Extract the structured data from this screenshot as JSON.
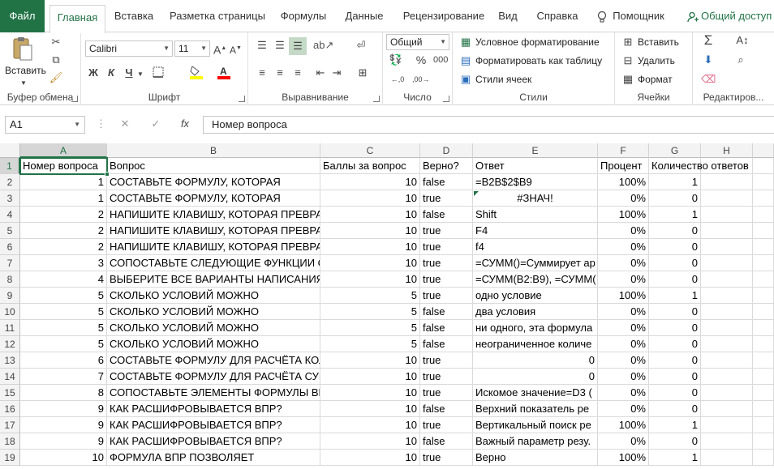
{
  "tabs": [
    {
      "label": "Файл"
    },
    {
      "label": "Главная"
    },
    {
      "label": "Вставка"
    },
    {
      "label": "Разметка страницы"
    },
    {
      "label": "Формулы"
    },
    {
      "label": "Данные"
    },
    {
      "label": "Рецензирование"
    },
    {
      "label": "Вид"
    },
    {
      "label": "Справка"
    }
  ],
  "tell_me": "Помощник",
  "share": "Общий доступ",
  "ribbon": {
    "clipboard": {
      "paste": "Вставить",
      "label": "Буфер обмена"
    },
    "font": {
      "name": "Calibri",
      "size": "11",
      "bold": "Ж",
      "italic": "К",
      "underline": "Ч",
      "label": "Шрифт"
    },
    "alignment": {
      "label": "Выравнивание"
    },
    "number": {
      "format": "Общий",
      "percent": "%",
      "label": "Число"
    },
    "styles": {
      "conditional": "Условное форматирование",
      "as_table": "Форматировать как таблицу",
      "cell_styles": "Стили ячеек",
      "label": "Стили"
    },
    "cells": {
      "insert": "Вставить",
      "delete": "Удалить",
      "format": "Формат",
      "label": "Ячейки"
    },
    "editing": {
      "label": "Редактиров..."
    }
  },
  "formula_bar": {
    "name_box": "A1",
    "fx": "fx",
    "value": "Номер вопроса"
  },
  "columns": [
    "A",
    "B",
    "C",
    "D",
    "E",
    "F",
    "G",
    "H"
  ],
  "header_row": [
    "Номер вопроса",
    "Вопрос",
    "Баллы за вопрос",
    "Верно?",
    "Ответ",
    "Процент",
    "Количество ответов",
    ""
  ],
  "rows": [
    [
      "1",
      "СОСТАВЬТЕ ФОРМУЛУ, КОТОРАЯ",
      "10",
      "false",
      "=B2B$2$B9",
      "100%",
      "1"
    ],
    [
      "1",
      "СОСТАВЬТЕ ФОРМУЛУ, КОТОРАЯ",
      "10",
      "true",
      "#ЗНАЧ!",
      "0%",
      "0"
    ],
    [
      "2",
      "НАПИШИТЕ КЛАВИШУ, КОТОРАЯ ПРЕВРА",
      "10",
      "false",
      "Shift",
      "100%",
      "1"
    ],
    [
      "2",
      "НАПИШИТЕ КЛАВИШУ, КОТОРАЯ ПРЕВРА",
      "10",
      "true",
      "F4",
      "0%",
      "0"
    ],
    [
      "2",
      "НАПИШИТЕ КЛАВИШУ, КОТОРАЯ ПРЕВРА",
      "10",
      "true",
      "f4",
      "0%",
      "0"
    ],
    [
      "3",
      "СОПОСТАВЬТЕ СЛЕДУЮЩИЕ ФУНКЦИИ С",
      "10",
      "true",
      "=СУММ()=Суммирует ар",
      "0%",
      "0"
    ],
    [
      "4",
      "ВЫБЕРИТЕ ВСЕ ВАРИАНТЫ НАПИСАНИЯ",
      "10",
      "true",
      "=СУММ(B2:B9), =СУММ(",
      "0%",
      "0"
    ],
    [
      "5",
      "СКОЛЬКО УСЛОВИЙ МОЖНО",
      "5",
      "true",
      "одно условие",
      "100%",
      "1"
    ],
    [
      "5",
      "СКОЛЬКО УСЛОВИЙ МОЖНО",
      "5",
      "false",
      "два условия",
      "0%",
      "0"
    ],
    [
      "5",
      "СКОЛЬКО УСЛОВИЙ МОЖНО",
      "5",
      "false",
      "ни одного, эта формула",
      "0%",
      "0"
    ],
    [
      "5",
      "СКОЛЬКО УСЛОВИЙ МОЖНО",
      "5",
      "false",
      "неограниченное количе",
      "0%",
      "0"
    ],
    [
      "6",
      "СОСТАВЬТЕ ФОРМУЛУ ДЛЯ РАСЧЁТА КОЛ",
      "10",
      "true",
      "0",
      "0%",
      "0"
    ],
    [
      "7",
      "СОСТАВЬТЕ ФОРМУЛУ ДЛЯ РАСЧЁТА СУМ",
      "10",
      "true",
      "0",
      "0%",
      "0"
    ],
    [
      "8",
      "СОПОСТАВЬТЕ ЭЛЕМЕНТЫ ФОРМУЛЫ ВПР",
      "10",
      "true",
      "Искомое значение=D3 (",
      "0%",
      "0"
    ],
    [
      "9",
      "КАК РАСШИФРОВЫВАЕТСЯ ВПР?",
      "10",
      "false",
      "Верхний показатель ре",
      "0%",
      "0"
    ],
    [
      "9",
      "КАК РАСШИФРОВЫВАЕТСЯ ВПР?",
      "10",
      "true",
      "Вертикальный поиск ре",
      "100%",
      "1"
    ],
    [
      "9",
      "КАК РАСШИФРОВЫВАЕТСЯ ВПР?",
      "10",
      "false",
      "Важный параметр резу.",
      "0%",
      "0"
    ],
    [
      "10",
      "ФОРМУЛА ВПР ПОЗВОЛЯЕТ",
      "10",
      "true",
      "Верно",
      "100%",
      "1"
    ]
  ],
  "colors": {
    "accent": "#217346"
  }
}
